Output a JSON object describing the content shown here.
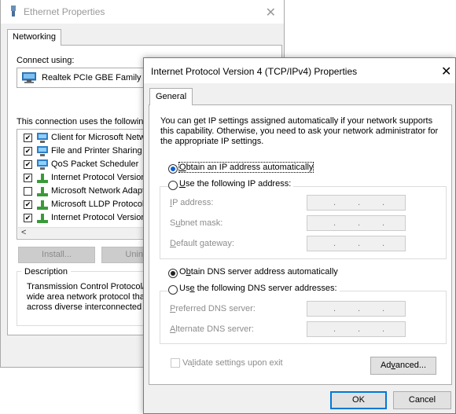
{
  "background_window": {
    "title": "Ethernet Properties",
    "tab": "Networking",
    "connect_using_label": "Connect using:",
    "adapter_name": "Realtek PCIe GBE Family Co",
    "components_label": "This connection uses the following",
    "components": [
      {
        "label": "Client for Microsoft Network",
        "checked": true,
        "icon": "network-client-icon"
      },
      {
        "label": "File and Printer Sharing fo",
        "checked": true,
        "icon": "network-client-icon"
      },
      {
        "label": "QoS Packet Scheduler",
        "checked": true,
        "icon": "network-service-icon"
      },
      {
        "label": "Internet Protocol Version",
        "checked": true,
        "icon": "network-protocol-icon"
      },
      {
        "label": "Microsoft Network Adapte",
        "checked": false,
        "icon": "network-protocol-icon"
      },
      {
        "label": "Microsoft LLDP Protocol",
        "checked": true,
        "icon": "network-protocol-icon"
      },
      {
        "label": "Internet Protocol Version",
        "checked": true,
        "icon": "network-protocol-icon"
      }
    ],
    "install_button": "Install...",
    "uninstall_button": "Unin",
    "description_title": "Description",
    "description_lines": [
      "Transmission Control Protocol/In",
      "wide area network protocol that",
      "across diverse interconnected n"
    ]
  },
  "dialog": {
    "title": "Internet Protocol Version 4 (TCP/IPv4) Properties",
    "tab": "General",
    "intro_text": "You can get IP settings assigned automatically if your network supports this capability. Otherwise, you need to ask your network administrator for the appropriate IP settings.",
    "ip_auto_label": "Obtain an IP address automatically",
    "ip_manual_label": "Use the following IP address:",
    "ip_fields": [
      {
        "label": "IP address:",
        "value": ". . ."
      },
      {
        "label": "Subnet mask:",
        "value": ". . ."
      },
      {
        "label": "Default gateway:",
        "value": ". . ."
      }
    ],
    "dns_auto_label": "Obtain DNS server address automatically",
    "dns_manual_label": "Use the following DNS server addresses:",
    "dns_fields": [
      {
        "label": "Preferred DNS server:",
        "value": ". . ."
      },
      {
        "label": "Alternate DNS server:",
        "value": ". . ."
      }
    ],
    "validate_label": "Validate settings upon exit",
    "advanced_button": "Advanced...",
    "ok_button": "OK",
    "cancel_button": "Cancel",
    "ip_mode": "automatic",
    "dns_mode": "automatic",
    "accent_color": "#0078d7"
  }
}
